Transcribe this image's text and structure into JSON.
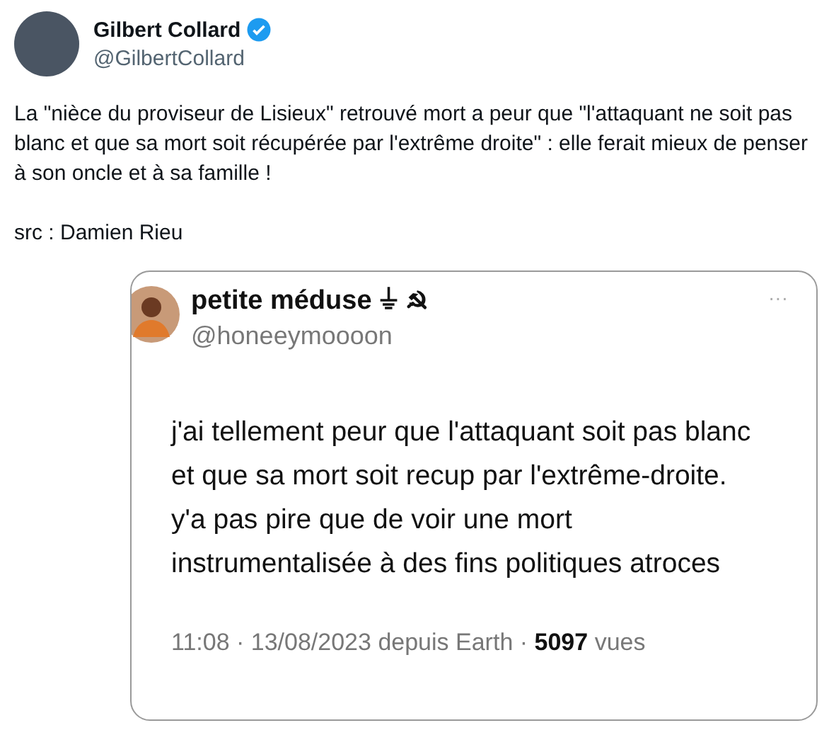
{
  "author": {
    "name": "Gilbert Collard",
    "verified": true,
    "handle": "@GilbertCollard"
  },
  "text": "La \"nièce du proviseur de Lisieux\" retrouvé mort a peur que \"l'attaquant ne soit pas blanc et que sa mort soit récupérée par l'extrême droite\" : elle ferait mieux de penser à son oncle et à sa famille !",
  "source": "src : Damien Rieu",
  "embedded": {
    "name": "petite méduse ⏚ ☭",
    "handle": "@honeeymoooon",
    "more": "···",
    "lines": [
      "j'ai tellement peur que l'attaquant soit pas blanc",
      "et que sa mort soit recup par l'extrême-droite.",
      "y'a pas pire que de voir une mort",
      "instrumentalisée à des fins politiques atroces"
    ],
    "footer": "11:08 · 13/08/2023 depuis Earth · **5097** vues"
  }
}
